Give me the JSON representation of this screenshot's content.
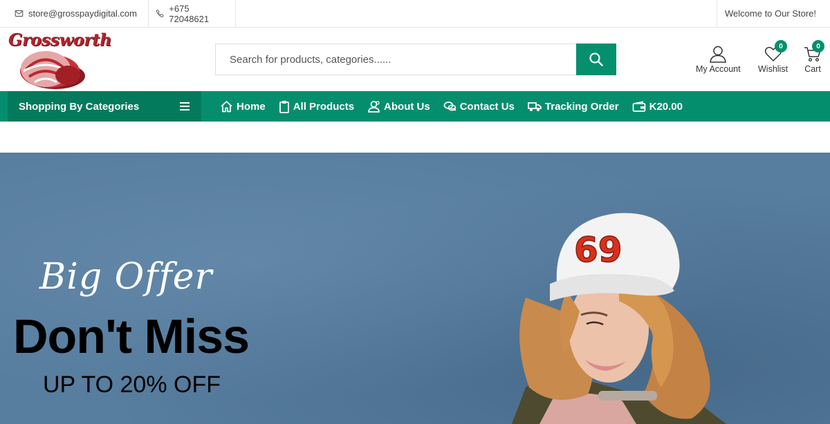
{
  "topbar": {
    "email": "store@grosspaydigital.com",
    "phone": "+675 72048621",
    "welcome": "Welcome to Our Store!"
  },
  "header": {
    "logo_text": "Grossworth",
    "search_placeholder": "Search for products, categories......",
    "account_label": "My Account",
    "wishlist_label": "Wishlist",
    "wishlist_count": "0",
    "cart_label": "Cart",
    "cart_count": "0"
  },
  "nav": {
    "categories_label": "Shopping By Categories",
    "items": [
      {
        "label": "Home",
        "icon": "home-icon"
      },
      {
        "label": "All Products",
        "icon": "clipboard-icon"
      },
      {
        "label": "About Us",
        "icon": "users-icon"
      },
      {
        "label": "Contact Us",
        "icon": "chat-icon"
      },
      {
        "label": "Tracking Order",
        "icon": "truck-icon"
      },
      {
        "label": "K20.00",
        "icon": "wallet-icon"
      }
    ]
  },
  "banner": {
    "script_text": "Big Offer",
    "headline": "Don't Miss",
    "subline": "UP TO 20% OFF",
    "cap_text": "69"
  },
  "colors": {
    "brand_green": "#058e6e",
    "dark_green": "#047a5c",
    "banner_bg": "#577d9f",
    "logo_red": "#b2242b"
  }
}
